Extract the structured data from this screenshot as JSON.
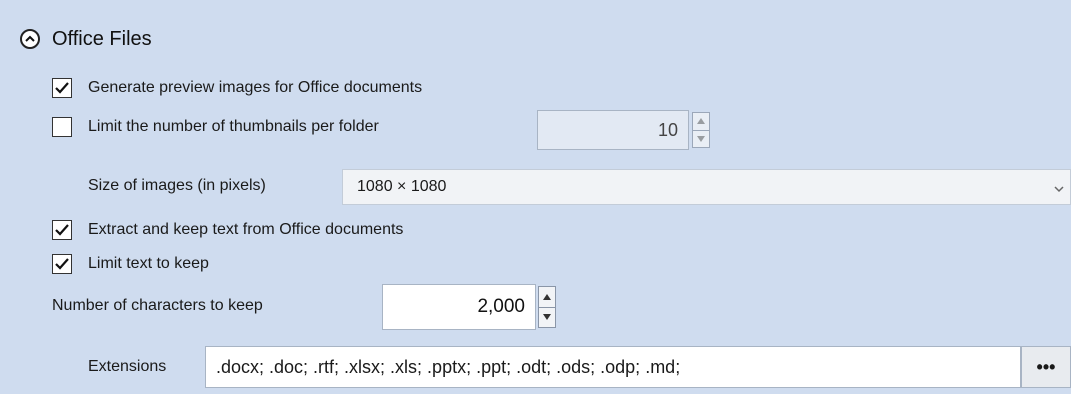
{
  "section": {
    "title": "Office Files",
    "icon": "chevron-up-circle-icon"
  },
  "options": {
    "generate_preview": {
      "label": "Generate preview images for Office documents",
      "checked": true
    },
    "limit_thumbnails": {
      "label": "Limit the number of thumbnails per folder",
      "checked": false,
      "value": "10"
    },
    "image_size": {
      "label": "Size of images (in pixels)",
      "value": "1080 × 1080"
    },
    "extract_text": {
      "label": "Extract and keep text from Office documents",
      "checked": true
    },
    "limit_text": {
      "label": "Limit text to keep",
      "checked": true
    },
    "num_chars": {
      "label": "Number of characters to keep",
      "value": "2,000"
    },
    "extensions": {
      "label": "Extensions",
      "value": ".docx; .doc; .rtf; .xlsx; .xls; .pptx; .ppt; .odt; .ods; .odp; .md;",
      "more_label": "•••"
    }
  }
}
